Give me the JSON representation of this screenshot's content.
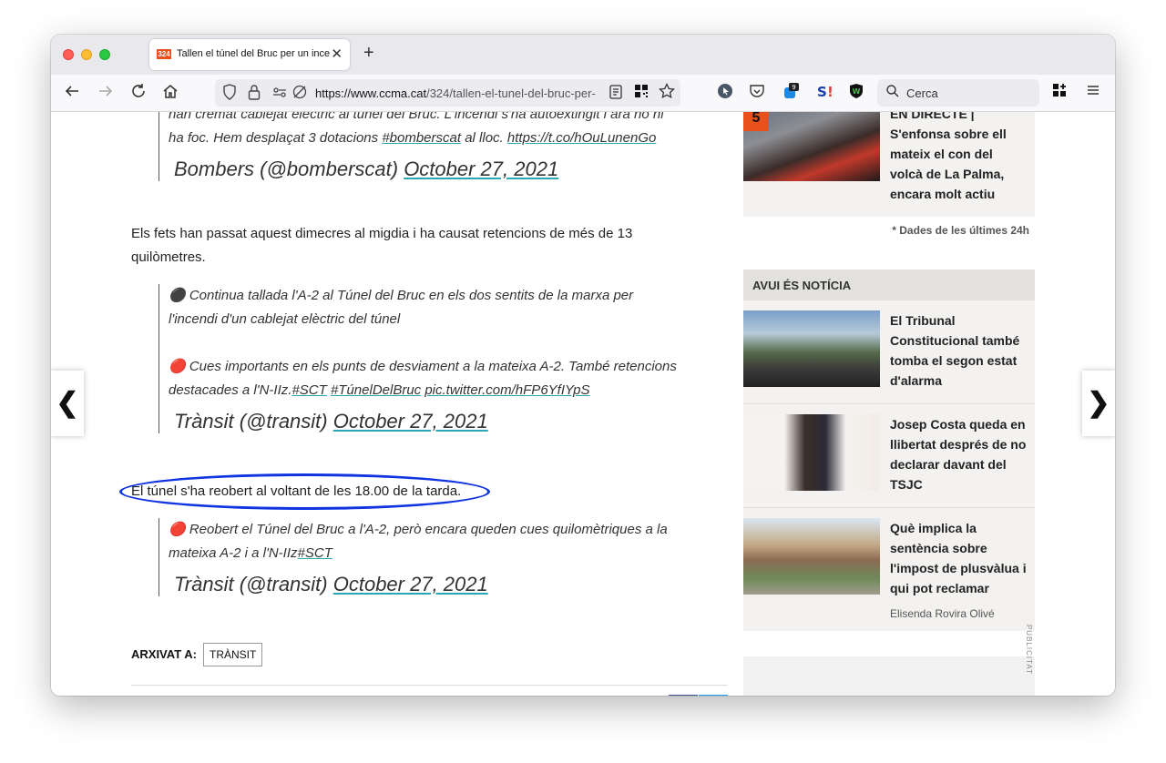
{
  "browser": {
    "tab_title": "Tallen el túnel del Bruc per un incendi",
    "tab_favicon": "324",
    "url_domain": "https://www.ccma.cat",
    "url_path": "/324/tallen-el-tunel-del-bruc-per-",
    "search_placeholder": "Cerca",
    "notification_badge": "9"
  },
  "article": {
    "top_quote_line1": "han cremat cablejat elèctric al túnel del Bruc. L'incendi s'ha autoextingit i ara no hi",
    "top_quote_line2_pre": "ha foc. Hem desplaçat 3 dotacions ",
    "top_quote_hashtag": "#bomberscat",
    "top_quote_line2_mid": " al lloc. ",
    "top_quote_link": "https://t.co/hOuLunenGo",
    "top_quote_author": "Bombers (@bomberscat) ",
    "top_quote_date": "October 27, 2021",
    "para1": "Els fets han passat aquest dimecres al migdia i ha causat retencions de més de 13 quilòmetres.",
    "quote2_line1": "⚫ Continua tallada l'A-2 al Túnel del Bruc en els dos sentits de la marxa per l'incendi d'un cablejat elèctric del túnel",
    "quote2_line2_pre": "🔴 Cues importants en els punts de desviament a la mateixa A-2. També retencions destacades a l'N-IIz.",
    "quote2_hashtag1": "#SCT",
    "quote2_hashtag2": "#TúnelDelBruc",
    "quote2_link": "pic.twitter.com/hFP6YfIYpS",
    "quote2_author": "Trànsit (@transit) ",
    "quote2_date": "October 27, 2021",
    "para2": "El túnel s'ha reobert al voltant de les 18.00 de la tarda.",
    "quote3_line": "🔴 Reobert el Túnel del Bruc a l'A-2, però encara queden cues quilomètriques a la mateixa A-2 i a l'N-IIz",
    "quote3_hashtag": "#SCT",
    "quote3_author": "Trànsit (@transit) ",
    "quote3_date": "October 27, 2021",
    "archive_label": "ARXIVAT A:",
    "archive_tag": "TRÀNSIT"
  },
  "sidebar": {
    "top_item": {
      "rank": "5",
      "title": "EN DIRECTE | S'enfonsa sobre ell mateix el con del volcà de La Palma, encara molt actiu"
    },
    "footnote": "* Dades de les últimes 24h",
    "section_title": "AVUI ÉS NOTÍCIA",
    "news": [
      {
        "title": "El Tribunal Constitucional també tomba el segon estat d'alarma"
      },
      {
        "title": "Josep Costa queda en llibertat després de no declarar davant del TSJC"
      },
      {
        "title": "Què implica la sentència sobre l'impost de plusvàlua i qui pot reclamar",
        "author": "Elisenda Rovira Olivé"
      }
    ],
    "ad_label": "PUBLICITAT"
  }
}
